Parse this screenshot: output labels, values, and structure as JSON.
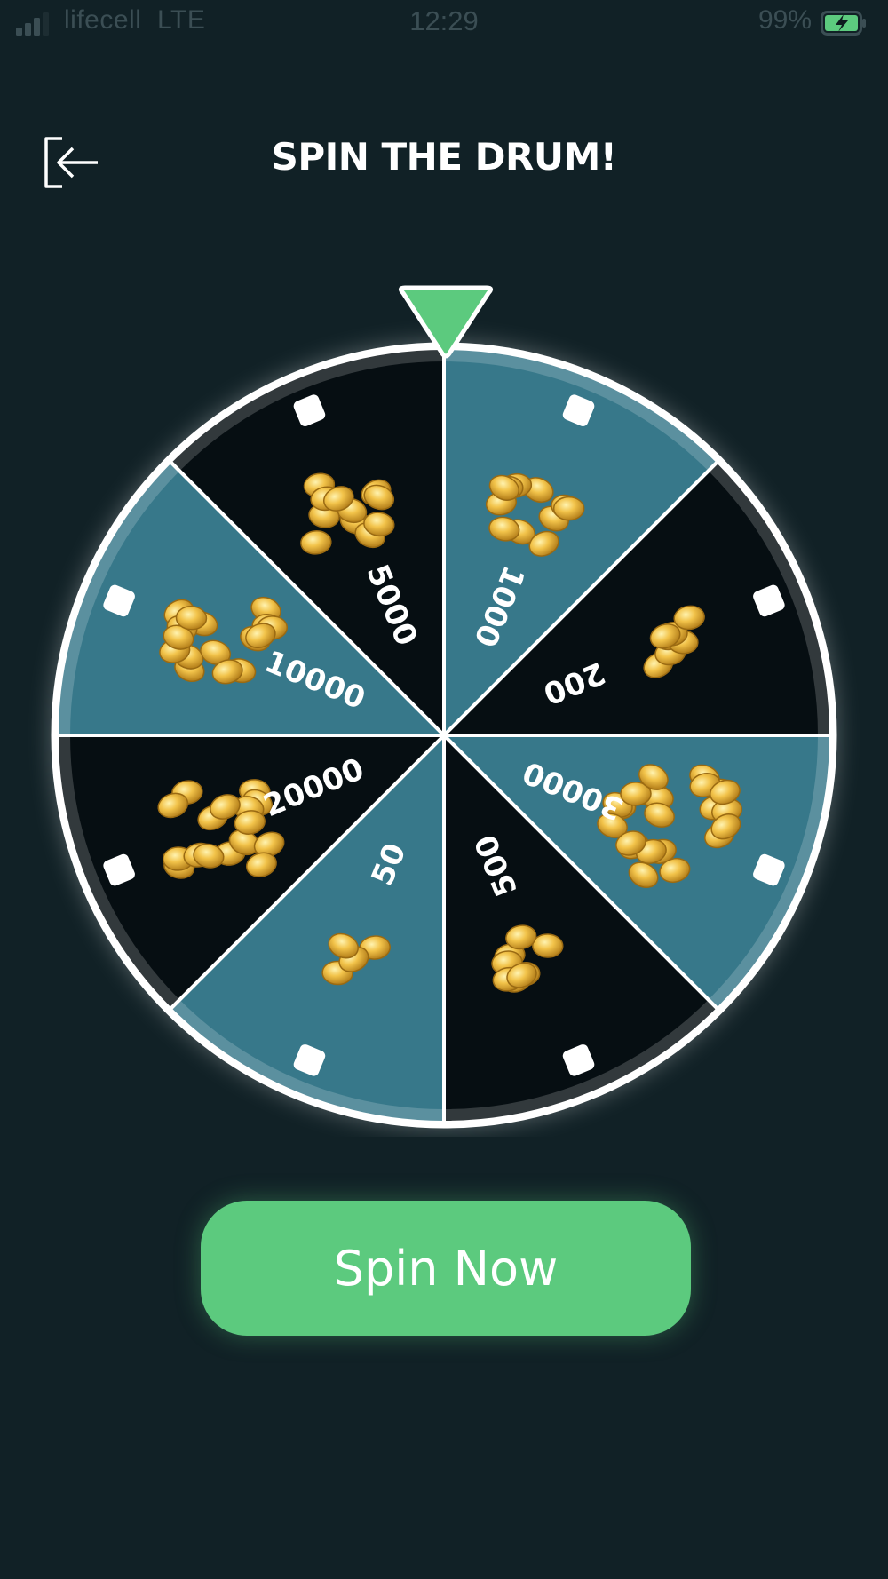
{
  "status_bar": {
    "carrier": "lifecell",
    "network": "LTE",
    "time": "12:29",
    "battery_percent": "99%",
    "icons": [
      "signal-icon",
      "battery-charging-icon"
    ]
  },
  "header": {
    "title": "SPIN THE DRUM!",
    "back_icon": "exit-arrow-icon"
  },
  "wheel": {
    "segments": [
      {
        "label": "1000",
        "theme": "teal",
        "coins": "coin-pile-medium"
      },
      {
        "label": "200",
        "theme": "dark",
        "coins": "coin-pile-small"
      },
      {
        "label": "30000",
        "theme": "teal",
        "coins": "coin-pile-huge"
      },
      {
        "label": "500",
        "theme": "dark",
        "coins": "coin-pile-small"
      },
      {
        "label": "50",
        "theme": "teal",
        "coins": "coin-pile-tiny"
      },
      {
        "label": "20000",
        "theme": "dark",
        "coins": "coin-pile-large"
      },
      {
        "label": "10000",
        "theme": "teal",
        "coins": "coin-pile-large"
      },
      {
        "label": "5000",
        "theme": "dark",
        "coins": "coin-pile-medium"
      }
    ],
    "pointer_icon": "triangle-pointer-icon"
  },
  "colors": {
    "background": "#112126",
    "teal_segment": "#37788a",
    "dark_segment": "#060e12",
    "accent_green": "#5cca7e",
    "coin_gold": "#f2c34a"
  },
  "spin_button": {
    "label": "Spin Now"
  }
}
